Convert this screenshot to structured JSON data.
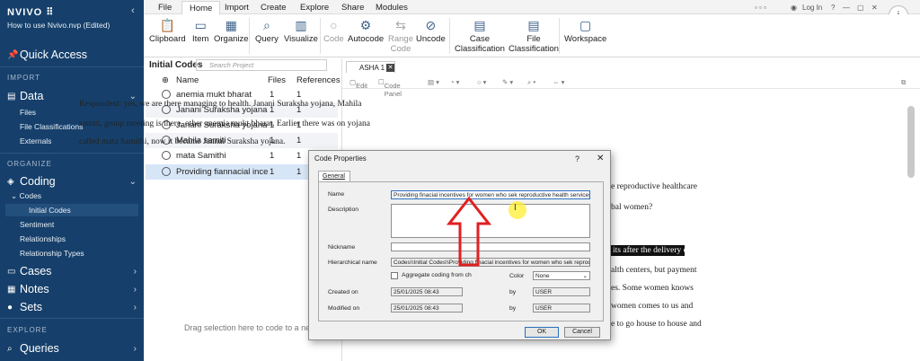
{
  "app": {
    "logo": "NVIVO",
    "logo_glyph": "⠿",
    "file_title": "How to use Nvivo.nvp (Edited)",
    "collapse_glyph": "‹"
  },
  "sidebar": {
    "quick_access": "Quick Access",
    "import_head": "IMPORT",
    "data": "Data",
    "data_items": [
      "Files",
      "File Classifications",
      "Externals"
    ],
    "organize_head": "ORGANIZE",
    "coding": "Coding",
    "codes": "Codes",
    "initial_codes": "Initial Codes",
    "coding_items": [
      "Sentiment",
      "Relationships",
      "Relationship Types"
    ],
    "cases": "Cases",
    "notes": "Notes",
    "sets": "Sets",
    "explore_head": "EXPLORE",
    "queries": "Queries"
  },
  "menu": [
    "File",
    "Home",
    "Import",
    "Create",
    "Explore",
    "Share",
    "Modules"
  ],
  "topright": {
    "login": "Log In",
    "info": "i"
  },
  "ribbon": {
    "clipboard": "Clipboard",
    "item": "Item",
    "organize": "Organize",
    "query": "Query",
    "visualize": "Visualize",
    "code": "Code",
    "autocode": "Autocode",
    "range1": "Range",
    "range2": "Code",
    "uncode": "Uncode",
    "case1": "Case",
    "case2": "Classification",
    "file1": "File",
    "file2": "Classification",
    "workspace": "Workspace"
  },
  "codes_panel": {
    "title": "Initial Codes",
    "search_placeholder": "Search Project",
    "col_name": "Name",
    "col_files": "Files",
    "col_refs": "References",
    "rows": [
      {
        "name": "anemia mukt bharat",
        "files": "1",
        "refs": "1"
      },
      {
        "name": "Janani Suraksha yojana",
        "files": "1",
        "refs": "1"
      },
      {
        "name": "Janani Suraksha yojana",
        "files": "1",
        "refs": "1"
      },
      {
        "name": "Mahila samiti",
        "files": "1",
        "refs": "1"
      },
      {
        "name": "mata Samithi",
        "files": "1",
        "refs": "1"
      },
      {
        "name": "Providing  fiannacial ince",
        "files": "1",
        "refs": "1"
      }
    ],
    "drag_hint": "Drag selection here to code to a new"
  },
  "document": {
    "tab": "ASHA 1",
    "toolbar": {
      "edit": "Edit",
      "code_panel": "Code Panel"
    },
    "lines": [
      "Respondent: yes, we are there managing to health. Janani Suraksha yojana, Mahila",
      "samiti, group meeting is there, other anemia mukt bharat. Earlier there was on yojana",
      "called mata Samithi, now it became Jannai Suraksha yojana."
    ],
    "right_fragments": [
      "e reproductive healthcare",
      "bal women?",
      "its after the delivery of",
      "alth centers, but payment",
      "es. Some women knows",
      "women comes to us and",
      "e to go house to house and"
    ]
  },
  "dialog": {
    "title": "Code Properties",
    "help": "?",
    "close": "✕",
    "tab_general": "General",
    "name_label": "Name",
    "name_value": "Providing  finacial incentives for women who sek reproductive health services",
    "description_label": "Description",
    "nickname_label": "Nickname",
    "hier_label": "Hierarchical name",
    "hier_value": "Codes\\\\Initial Codes\\\\Providing  finacial incentives for women who sek reproductive he",
    "aggregate_label": "Aggregate coding from ch",
    "color_label": "Color",
    "color_value": "None",
    "created_label": "Created on",
    "created_value": "25/01/2025 08:43",
    "modified_label": "Modified on",
    "modified_value": "25/01/2025 08:43",
    "by_label": "by",
    "created_by": "USER",
    "modified_by": "USER",
    "ok": "OK",
    "cancel": "Cancel"
  },
  "colors": {
    "sidebar_bg": "#16406b",
    "accent": "#3a5f87",
    "arrow": "#e02020",
    "highlight": "#d7e6f7"
  }
}
